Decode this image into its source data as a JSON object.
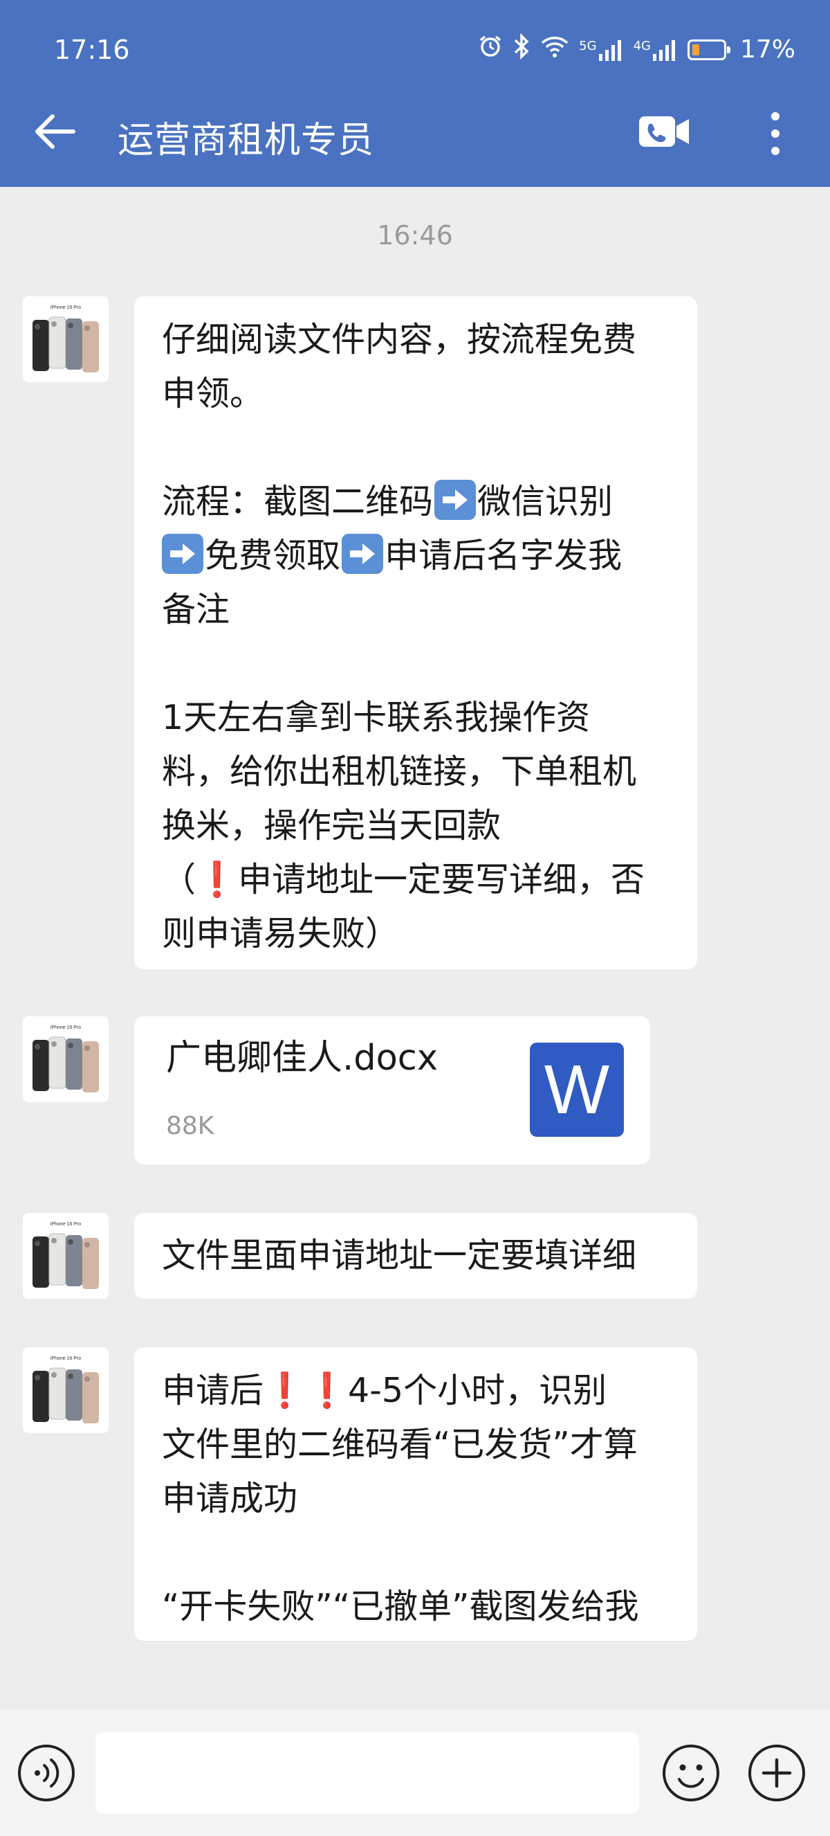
{
  "status_bar": {
    "time": "17:16",
    "network_1": "5G",
    "network_2": "4G",
    "battery": "17%"
  },
  "header": {
    "title": "运营商租机专员",
    "bg_color": "#4a72c1"
  },
  "chat": {
    "time_separator": "16:46",
    "messages": [
      {
        "type": "text",
        "lines": {
          "l1": "仔细阅读文件内容，按流程免费",
          "l2": "申领。",
          "l3a": "流程：截图二维码",
          "l3b": "微信识别",
          "l4a": "免费领取",
          "l4b": "申请后名字发我",
          "l5": "备注",
          "l6": "1天左右拿到卡联系我操作资",
          "l7": "料，给你出租机链接，下单租机",
          "l8": "换米，操作完当天回款",
          "l9a": "（",
          "l9b": "❗",
          "l9c": "申请地址一定要写详细，否",
          "l10": "则申请易失败）"
        }
      },
      {
        "type": "file",
        "file_name": "广电卿佳人.docx",
        "file_size": "88K",
        "icon_letter": "W"
      },
      {
        "type": "text",
        "text": "文件里面申请地址一定要填详细"
      },
      {
        "type": "text",
        "lines": {
          "l1a": "申请后",
          "l1b": "❗❗",
          "l1c": "4-5个小时，识别",
          "l2": "文件里的二维码看“已发货”才算",
          "l3": "申请成功",
          "l4": "“开卡失败”“已撤单”截图发给我"
        }
      }
    ]
  },
  "avatar": {
    "label": "iPhone 16 Pro"
  },
  "input_bar": {
    "placeholder": ""
  }
}
